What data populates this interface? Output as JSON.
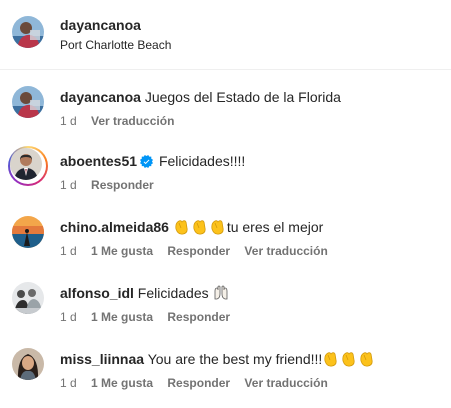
{
  "post": {
    "username": "dayancanoa",
    "location": "Port Charlotte Beach"
  },
  "comments": [
    {
      "username": "dayancanoa",
      "text": "Juegos del Estado de la Florida",
      "time": "1 d",
      "actions": [
        "Ver traducción"
      ],
      "avatar": "person-on-beach"
    },
    {
      "username": "aboentes51",
      "verified": true,
      "text": "Felicidades!!!!",
      "time": "1 d",
      "actions": [
        "Responder"
      ],
      "avatar": "person-in-suit",
      "story_ring": true
    },
    {
      "username": "chino.almeida86",
      "text": "tu eres el mejor",
      "emoji_prefix": "👏👏👏",
      "time": "1 d",
      "likes": "1 Me gusta",
      "actions": [
        "Responder",
        "Ver traducción"
      ],
      "avatar": "sunset-sea"
    },
    {
      "username": "alfonso_idl",
      "text": "Felicidades",
      "emoji_suffix": "🙌",
      "time": "1 d",
      "likes": "1 Me gusta",
      "actions": [
        "Responder"
      ],
      "avatar": "group-photo"
    },
    {
      "username": "miss_liinnaa",
      "text": "You are the best my friend!!!",
      "emoji_suffix": "👏👏👏",
      "time": "1 d",
      "likes": "1 Me gusta",
      "actions": [
        "Responder",
        "Ver traducción"
      ],
      "avatar": "woman-portrait"
    }
  ],
  "colors": {
    "text": "#262626",
    "secondary": "#737373",
    "verified": "#0095f6",
    "divider": "#efefef"
  }
}
